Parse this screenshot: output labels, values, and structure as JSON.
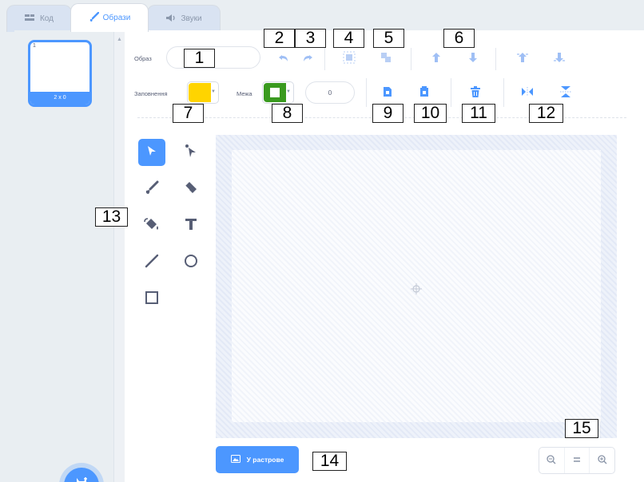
{
  "tabs": [
    {
      "label": "Код",
      "icon": "code-icon"
    },
    {
      "label": "Образи",
      "icon": "brush-icon"
    },
    {
      "label": "Звуки",
      "icon": "speaker-icon"
    }
  ],
  "costume": {
    "number": "1",
    "size": "2 x 0"
  },
  "toolbar": {
    "name_label": "Образ",
    "name_value": "",
    "fill_label": "Заповнення",
    "outline_label": "Межа",
    "outline_width": "0",
    "fill_color": "#ffd400",
    "outline_color": "#3a9a1f"
  },
  "bitmap_button": {
    "label": "У растрове"
  },
  "callouts": [
    "1",
    "2",
    "3",
    "4",
    "5",
    "6",
    "7",
    "8",
    "9",
    "10",
    "11",
    "12",
    "13",
    "14",
    "15"
  ],
  "accent_color": "#4c97ff"
}
